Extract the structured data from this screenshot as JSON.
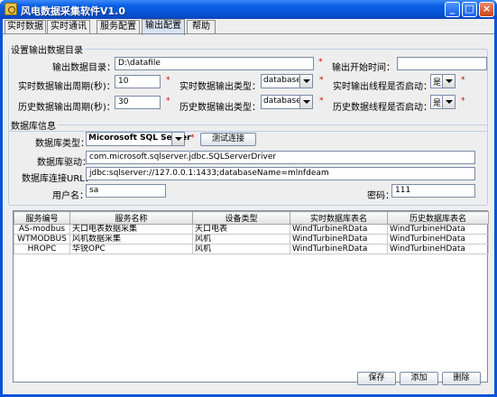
{
  "window": {
    "title": "风电数据采集软件V1.0",
    "minimize": "_",
    "maximize": "□",
    "close": "×"
  },
  "tabs": [
    "实时数据",
    "实时通讯",
    "服务配置",
    "输出配置",
    "帮助"
  ],
  "active_tab": "输出配置",
  "output": {
    "legend": "设置输出数据目录",
    "dir_label": "输出数据目录：",
    "dir_value": "D:\\datafile",
    "start_time_label": "输出开始时间：",
    "start_time_value": "",
    "rt_period_label": "实时数据输出周期(秒)：",
    "rt_period_value": "10",
    "rt_type_label": "实时数据输出类型：",
    "rt_type_value": "database",
    "rt_thread_label": "实时输出线程是否启动：",
    "rt_thread_value": "是",
    "hist_period_label": "历史数据输出周期(秒)：",
    "hist_period_value": "30",
    "hist_type_label": "历史数据输出类型：",
    "hist_type_value": "database",
    "hist_thread_label": "历史数据线程是否启动：",
    "hist_thread_value": "是",
    "required": "*"
  },
  "db": {
    "legend": "数据库信息",
    "type_label": "数据库类型：",
    "type_value": "Micorosoft SQL Server",
    "test_button": "测试连接",
    "driver_label": "数据库驱动：",
    "driver_value": "com.microsoft.sqlserver.jdbc.SQLServerDriver",
    "url_label": "数据库连接URL：",
    "url_value": "jdbc:sqlserver://127.0.0.1:1433;databaseName=mlnfdeam",
    "user_label": "用户名：",
    "user_value": "sa",
    "password_label": "密码：",
    "password_value": "111"
  },
  "table": {
    "headers": [
      "服务编号",
      "服务名称",
      "设备类型",
      "实时数据库表名",
      "历史数据库表名"
    ],
    "rows": [
      [
        "AS-modbus",
        "天口电表数据采集",
        "天口电表",
        "WindTurbineRData",
        "WindTurbineHData"
      ],
      [
        "WTMODBUS",
        "风机数据采集",
        "风机",
        "WindTurbineRData",
        "WindTurbineHData"
      ],
      [
        "HROPC",
        "华锐OPC",
        "风机",
        "WindTurbineRData",
        "WindTurbineHData"
      ]
    ]
  },
  "buttons": {
    "save": "保存",
    "add": "添加",
    "delete": "删除"
  }
}
